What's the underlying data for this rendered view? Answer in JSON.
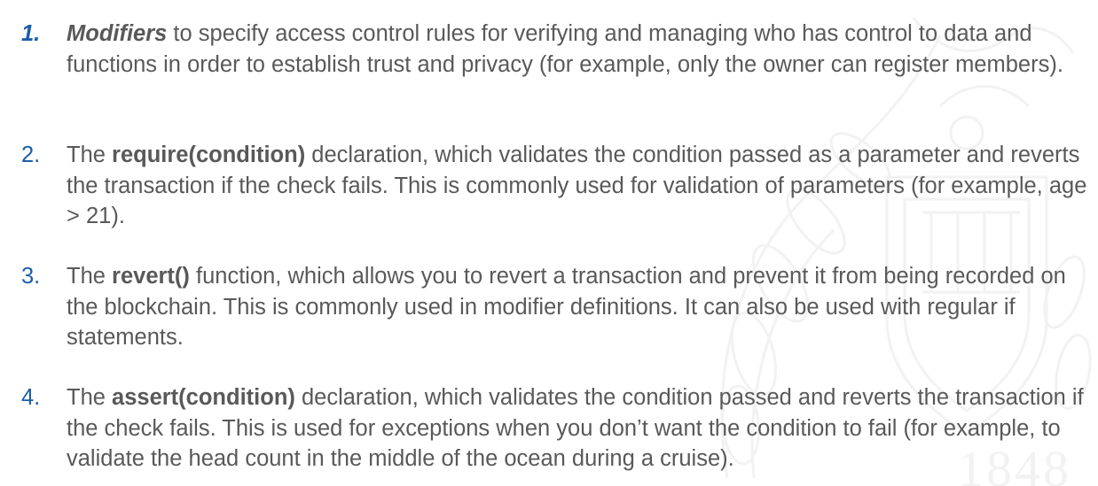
{
  "items": [
    {
      "number": "1.",
      "lead": "Modifiers",
      "text": " to specify access control rules for verifying and managing who has control to data and functions in order to establish trust and privacy (for example, only the owner can register members)."
    },
    {
      "number": "2.",
      "pre": "The ",
      "keyword": "require(condition)",
      "text": " declaration, which validates the condition passed as a parameter and reverts the transaction if the check fails. This is commonly used for validation of parameters (for example, age > 21)."
    },
    {
      "number": "3.",
      "pre": "The ",
      "keyword": "revert()",
      "text": " function, which allows you to revert a transaction and prevent it from being recorded on the blockchain. This is commonly used in modifier definitions. It can also be used with regular if statements."
    },
    {
      "number": "4.",
      "pre": "The ",
      "keyword": "assert(condition)",
      "text": " declaration, which validates the condition passed and reverts the transaction if the check fails. This is used for exceptions when you don’t want the condition to fail (for example, to validate the head count in the middle of the ocean during a cruise)."
    }
  ],
  "colors": {
    "number": "#1a5ea8",
    "body_text": "#595959",
    "watermark": "#8a8a8a"
  },
  "watermark": {
    "icon": "university-seal-icon",
    "year_digit_1": "1",
    "year_digit_2": "8",
    "year_digit_3": "4",
    "year_digit_4": "8"
  }
}
